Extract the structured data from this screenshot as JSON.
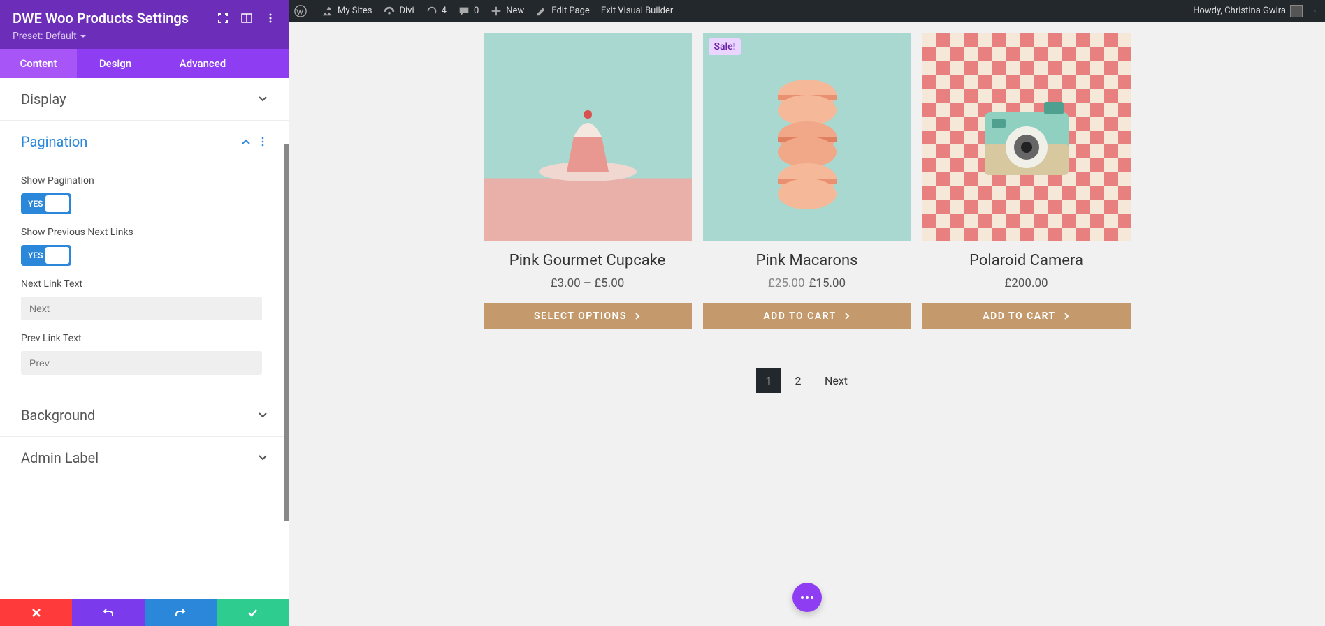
{
  "adminbar": {
    "my_sites": "My Sites",
    "divi": "Divi",
    "updates_count": "4",
    "comments_count": "0",
    "new": "New",
    "edit_page": "Edit Page",
    "exit_builder": "Exit Visual Builder",
    "howdy": "Howdy, Christina Gwira"
  },
  "panel": {
    "title": "DWE Woo Products Settings",
    "preset_label": "Preset: Default",
    "tabs": {
      "content": "Content",
      "design": "Design",
      "advanced": "Advanced"
    },
    "sections": {
      "display": "Display",
      "pagination": "Pagination",
      "background": "Background",
      "admin_label": "Admin Label"
    },
    "fields": {
      "show_pagination": "Show Pagination",
      "show_prev_next": "Show Previous Next Links",
      "next_link_text": "Next Link Text",
      "prev_link_text": "Prev Link Text",
      "toggle_yes": "YES",
      "next_placeholder": "Next",
      "prev_placeholder": "Prev"
    }
  },
  "products": [
    {
      "title": "Pink Gourmet Cupcake",
      "price_html": "£3.00 – £5.00",
      "button": "SELECT OPTIONS",
      "sale": false
    },
    {
      "title": "Pink Macarons",
      "price_old": "£25.00",
      "price_new": "£15.00",
      "button": "ADD TO CART",
      "sale": true,
      "sale_label": "Sale!"
    },
    {
      "title": "Polaroid Camera",
      "price_html": "£200.00",
      "button": "ADD TO CART",
      "sale": false
    }
  ],
  "pagination": {
    "page1": "1",
    "page2": "2",
    "next": "Next"
  }
}
